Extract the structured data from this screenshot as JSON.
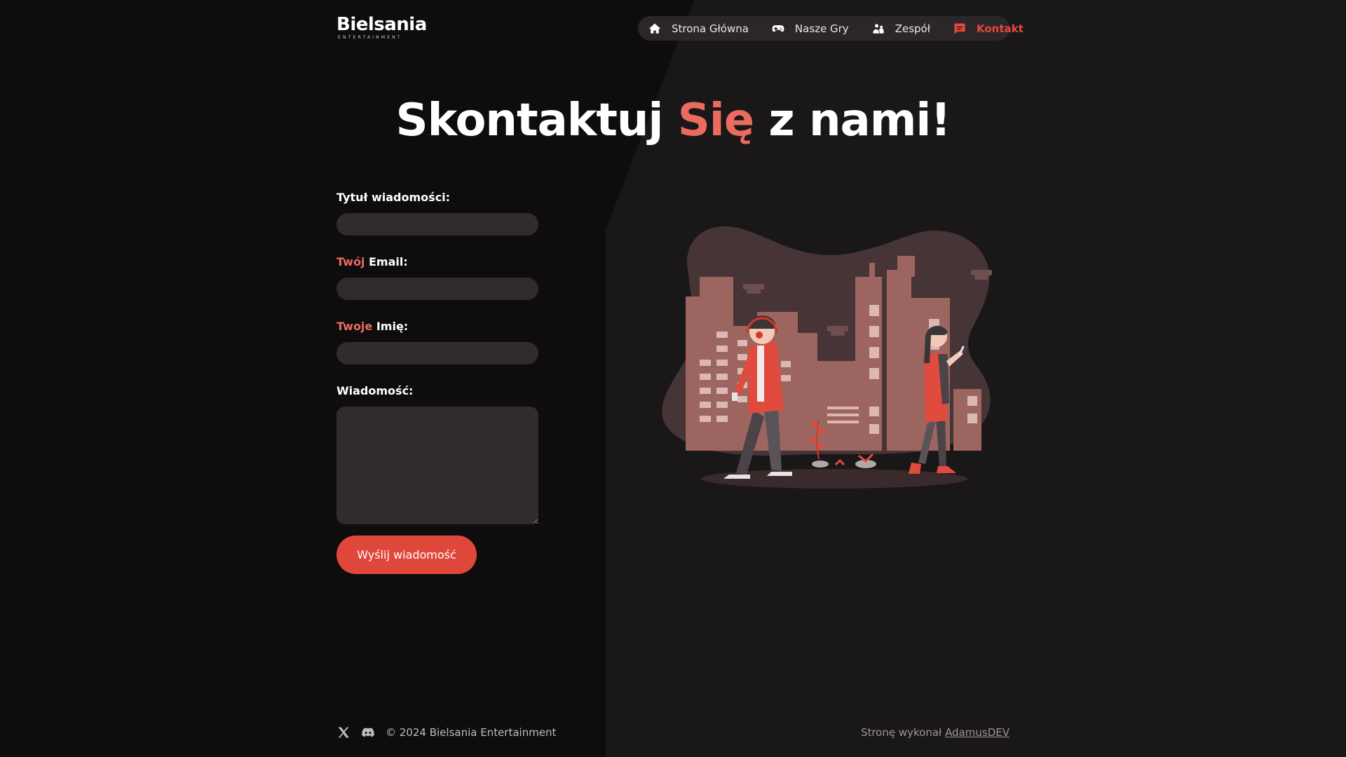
{
  "colors": {
    "background_left": "#0e0c0d",
    "background_right": "#1a1719",
    "accent": "#e8473a",
    "accent_soft": "#ea6b60",
    "field": "#302b2e",
    "nav": "#2b2729"
  },
  "brand": {
    "logo_text": "Bielsania",
    "logo_sub": "ENTERTAINMENT"
  },
  "nav": {
    "items": [
      {
        "label": "Strona Główna",
        "icon": "home-icon"
      },
      {
        "label": "Nasze Gry",
        "icon": "gamepad-icon"
      },
      {
        "label": "Zespół",
        "icon": "team-icon"
      },
      {
        "label": "Kontakt",
        "icon": "chat-icon",
        "active": true
      }
    ]
  },
  "heading": {
    "before": "Skontaktuj ",
    "accent": "Się",
    "after": " z nami!"
  },
  "form": {
    "title_label": "Tytuł wiadomości:",
    "email_label_accent": "Twój",
    "email_label_rest": " Email:",
    "name_label_accent": "Twoje",
    "name_label_rest": " Imię:",
    "message_label": "Wiadomość:",
    "title_value": "",
    "email_value": "",
    "name_value": "",
    "message_value": "",
    "submit_label": "Wyślij wiadomość"
  },
  "footer": {
    "copyright": "© 2024 Bielsania Entertainment",
    "credit_prefix": "Stronę wykonał ",
    "credit_link": "AdamusDEV",
    "social": [
      "x-icon",
      "discord-icon"
    ]
  }
}
